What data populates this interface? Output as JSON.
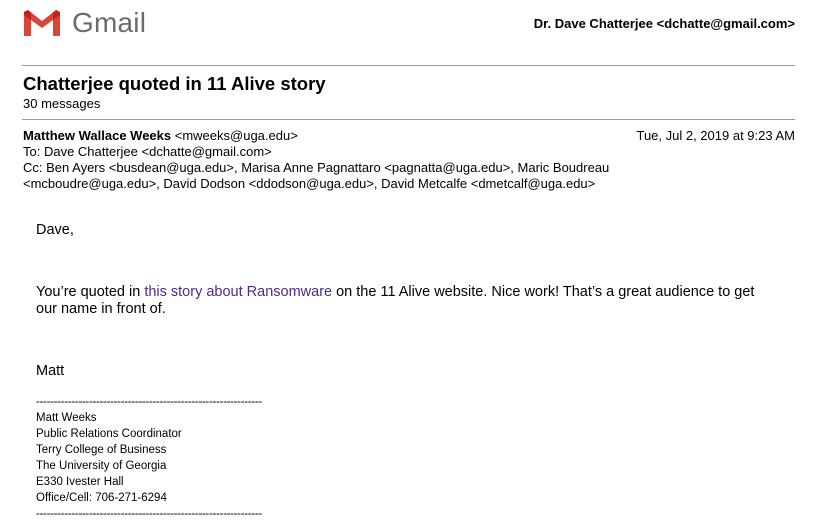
{
  "header": {
    "logo_text": "Gmail",
    "account": "Dr. Dave Chatterjee <dchatte@gmail.com>"
  },
  "thread": {
    "subject": "Chatterjee quoted in 11 Alive story",
    "count": "30 messages"
  },
  "message": {
    "from": "Matthew Wallace Weeks <mweeks@uga.edu>",
    "from_name": "Matthew Wallace Weeks",
    "from_email": "<mweeks@uga.edu>",
    "date": "Tue, Jul 2, 2019 at 9:23 AM",
    "to": "To: Dave Chatterjee <dchatte@gmail.com>",
    "cc_line1": "Cc: Ben Ayers <busdean@uga.edu>, Marisa Anne Pagnattaro <pagnatta@uga.edu>, Maric Boudreau",
    "cc_line2": "<mcboudre@uga.edu>, David Dodson <ddodson@uga.edu>, David Metcalfe <dmetcalf@uga.edu>",
    "greeting": "Dave,",
    "para_before": "You’re quoted in ",
    "link_text": "this story about Ransomware",
    "para_after": " on the 11 Alive website. Nice work! That’s a great audience to get our name in front of.",
    "signoff": "Matt"
  },
  "signature": {
    "separator": "----------------------------------------------------------------",
    "lines": [
      "Matt Weeks",
      "Public Relations Coordinator",
      "Terry College of Business",
      "The University of Georgia",
      "E330 Ivester Hall",
      "Office/Cell: 706-271-6294"
    ]
  },
  "colors": {
    "gmail_red": "#db4437",
    "link": "#4b2a8c",
    "rule": "#9a9a9a"
  }
}
